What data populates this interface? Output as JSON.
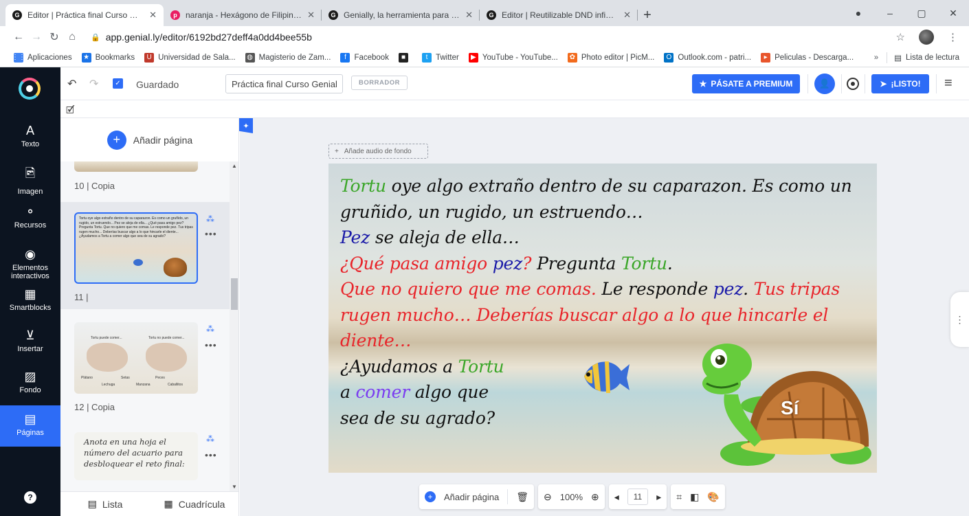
{
  "browser": {
    "tabs": [
      {
        "title": "Editor | Práctica final Curso Geni",
        "active": true,
        "favicon": "genially-icon"
      },
      {
        "title": "naranja - Hexágono de Filipinas",
        "active": false,
        "favicon": "png-icon"
      },
      {
        "title": "Genially, la herramienta para crea",
        "active": false,
        "favicon": "genially-icon"
      },
      {
        "title": "Editor | Reutilizable DND infinito",
        "active": false,
        "favicon": "genially-icon"
      }
    ],
    "new_tab": "+",
    "url": "app.genial.ly/editor/6192bd27deff4a0dd4bee55b",
    "bookmarks": [
      {
        "label": "Aplicaciones",
        "icon": "apps-grid-icon",
        "color": "#4285f4"
      },
      {
        "label": "Bookmarks",
        "icon": "star-icon",
        "color": "#1a73e8"
      },
      {
        "label": "Universidad de Sala...",
        "icon": "usal-icon",
        "color": "#c0392b"
      },
      {
        "label": "Magisterio de Zam...",
        "icon": "globe-icon",
        "color": "#555555"
      },
      {
        "label": "Facebook",
        "icon": "facebook-icon",
        "color": "#1877f2"
      },
      {
        "label": "",
        "icon": "app-icon",
        "color": "#222222"
      },
      {
        "label": "Twitter",
        "icon": "twitter-icon",
        "color": "#1da1f2"
      },
      {
        "label": "YouTube - YouTube...",
        "icon": "youtube-icon",
        "color": "#ff0000"
      },
      {
        "label": "Photo editor | PicM...",
        "icon": "picmonkey-icon",
        "color": "#f26b1d"
      },
      {
        "label": "Outlook.com - patri...",
        "icon": "outlook-icon",
        "color": "#0072c6"
      },
      {
        "label": "Peliculas - Descarga...",
        "icon": "movie-icon",
        "color": "#e8552c"
      }
    ],
    "more_bookmarks": "»",
    "reading_list": "Lista de lectura"
  },
  "topbar": {
    "saved_label": "Guardado",
    "title_value": "Práctica final Curso Genial",
    "draft_badge": "BORRADOR",
    "premium_label": "PÁSATE A PREMIUM",
    "ready_label": "¡LISTO!"
  },
  "leftnav": [
    {
      "label": "Texto",
      "icon": "A"
    },
    {
      "label": "Imagen",
      "icon": "🖻"
    },
    {
      "label": "Recursos",
      "icon": "⚬"
    },
    {
      "label": "Elementos interactivos",
      "icon": "◉"
    },
    {
      "label": "Smartblocks",
      "icon": "▦"
    },
    {
      "label": "Insertar",
      "icon": "⊻"
    },
    {
      "label": "Fondo",
      "icon": "▨"
    },
    {
      "label": "Páginas",
      "icon": "▤",
      "active": true
    }
  ],
  "pages_panel": {
    "add_page": "Añadir página",
    "page10_label": "10 | Copia",
    "page11_label": "11 |",
    "page12_label": "12 | Copia",
    "page13_text": "Anota en una hoja el número del acuario para desbloquear el reto final:",
    "view_list": "Lista",
    "view_grid": "Cuadrícula"
  },
  "thumb11_text": "Tortu oye algo extraño dentro de su caparazon. Es como un gruñido, un rugido, un estruendo... Pez se aleja de ella... ¿Qué pasa amigo pez? Pregunta Tortu. Que no quiero que me comas. Le responde pez. Tus tripas rugen mucho... Deberías buscar algo a lo que hincarle el diente... ¿Ayudamos a Tortu a comer algo que sea de su agrado?",
  "thumb12_texts": [
    "Tortu puede comer...",
    "Tortu no puede comer...",
    "Plátano",
    "Setas",
    "Peces",
    "Lechuga",
    "Manzana",
    "Caballitos"
  ],
  "audio_label": "Añade audio de fondo",
  "slide": {
    "segments": [
      {
        "text": "Tortu",
        "color": "green"
      },
      {
        "text": " oye algo extraño dentro de su caparazon. Es como un gruñido, un rugido, un estruendo…",
        "color": "black",
        "br": true
      },
      {
        "text": "Pez",
        "color": "blue"
      },
      {
        "text": " se aleja de ella…",
        "color": "black",
        "br": true
      },
      {
        "text": "¿Qué pasa amigo ",
        "color": "red"
      },
      {
        "text": "pez",
        "color": "blue"
      },
      {
        "text": "?",
        "color": "red"
      },
      {
        "text": " Pregunta ",
        "color": "black"
      },
      {
        "text": "Tortu",
        "color": "green"
      },
      {
        "text": ".",
        "color": "black",
        "br": true
      },
      {
        "text": "Que no quiero que me comas.",
        "color": "red"
      },
      {
        "text": " Le responde ",
        "color": "black"
      },
      {
        "text": "pez",
        "color": "blue"
      },
      {
        "text": ".",
        "color": "black"
      },
      {
        "text": " Tus tripas rugen mucho… Deberías buscar algo a lo que hincarle el diente…",
        "color": "red",
        "br": true
      },
      {
        "text": "¿Ayudamos a ",
        "color": "black"
      },
      {
        "text": "Tortu",
        "color": "green",
        "br": true
      },
      {
        "text": "a ",
        "color": "black"
      },
      {
        "text": "comer",
        "color": "purple"
      },
      {
        "text": " algo que",
        "color": "black",
        "br": true
      },
      {
        "text": "sea de su agrado?",
        "color": "black"
      }
    ],
    "shell_label": "Sí"
  },
  "bottom_toolbar": {
    "add_page": "Añadir página",
    "zoom": "100%",
    "page_number": "11"
  },
  "colors": {
    "accent": "#2d6cf6",
    "nav_bg": "#0c1420"
  }
}
